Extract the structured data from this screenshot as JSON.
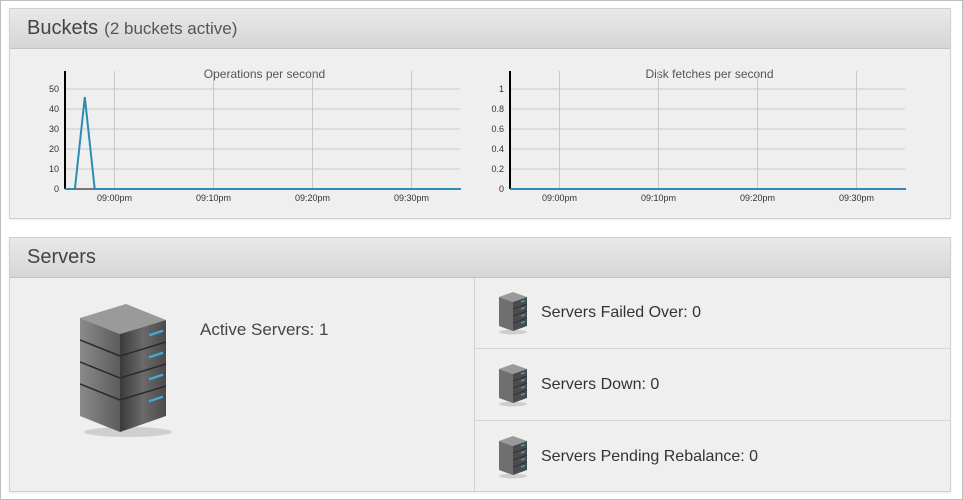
{
  "buckets": {
    "title": "Buckets",
    "subtitle": "(2 buckets active)"
  },
  "chart_data": [
    {
      "type": "line",
      "title": "Operations per second",
      "x_ticks": [
        "09:00pm",
        "09:10pm",
        "09:20pm",
        "09:30pm"
      ],
      "y_ticks": [
        "0",
        "10",
        "20",
        "30",
        "40",
        "50"
      ],
      "ylim": [
        0,
        55
      ],
      "series": [
        {
          "color": "#2f8bb5",
          "x": [
            "08:55pm",
            "08:56pm",
            "08:57pm",
            "08:58pm",
            "09:00pm",
            "09:10pm",
            "09:20pm",
            "09:30pm",
            "09:35pm"
          ],
          "values": [
            0,
            0,
            46,
            0,
            0,
            0,
            0,
            0,
            0
          ]
        }
      ],
      "grid": true
    },
    {
      "type": "line",
      "title": "Disk fetches per second",
      "x_ticks": [
        "09:00pm",
        "09:10pm",
        "09:20pm",
        "09:30pm"
      ],
      "y_ticks": [
        "0",
        "0.2",
        "0.4",
        "0.6",
        "0.8",
        "1"
      ],
      "ylim": [
        0,
        1.1
      ],
      "series": [
        {
          "color": "#2f8bb5",
          "x": [
            "08:55pm",
            "09:00pm",
            "09:10pm",
            "09:20pm",
            "09:30pm",
            "09:35pm"
          ],
          "values": [
            0,
            0,
            0,
            0,
            0,
            0
          ]
        }
      ],
      "grid": true
    }
  ],
  "servers": {
    "title": "Servers",
    "active_label": "Active Servers: 1",
    "status": [
      {
        "label": "Servers Failed Over: 0",
        "icon": "server-icon"
      },
      {
        "label": "Servers Down: 0",
        "icon": "server-icon"
      },
      {
        "label": "Servers Pending Rebalance: 0",
        "icon": "server-icon"
      }
    ]
  },
  "colors": {
    "accent": "#2f8bb5",
    "panel_bg": "#efefef",
    "header_bg": "#d9d9d9"
  }
}
